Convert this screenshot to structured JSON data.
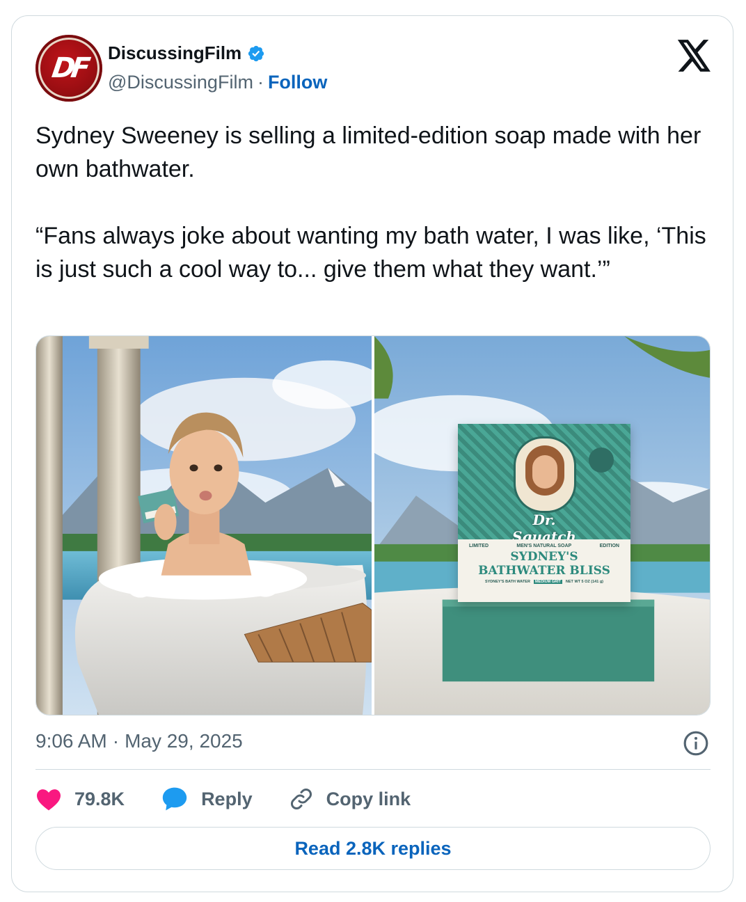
{
  "author": {
    "name": "DiscussingFilm",
    "handle": "@DiscussingFilm",
    "separator": "·",
    "follow_label": "Follow",
    "verified": true,
    "avatar_mark": "DF"
  },
  "tweet": {
    "paragraphs": [
      "Sydney Sweeney is selling a limited-edition soap made with her own bathwater.",
      "“Fans always joke about wanting my bath water, I was like, ‘This is just such a cool way to... give them what they want.’”"
    ]
  },
  "media": {
    "left_image": "photo-woman-in-bathtub",
    "right_image": "photo-soap-box",
    "soap_box": {
      "brand": "Dr. Squatch",
      "top_line": [
        "LIMITED",
        "MEN'S NATURAL SOAP",
        "EDITION"
      ],
      "title_line1": "SYDNEY'S",
      "title_line2": "BATHWATER BLISS",
      "bottom_line": [
        "SYDNEY'S BATH WATER",
        "MEDIUM GRIT",
        "NET WT 5 OZ (141 g)"
      ]
    }
  },
  "meta": {
    "time": "9:06 AM",
    "separator": "·",
    "date": "May 29, 2025"
  },
  "actions": {
    "likes": "79.8K",
    "reply_label": "Reply",
    "copy_link_label": "Copy link"
  },
  "replies_button": "Read 2.8K replies",
  "colors": {
    "like": "#f91880",
    "link_blue": "#0a64bc",
    "reply_icon": "#1d9bf0",
    "muted": "#536471",
    "border": "#cfd9de"
  }
}
